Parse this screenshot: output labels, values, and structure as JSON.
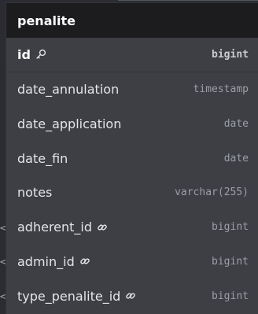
{
  "table": {
    "title": "penalite",
    "columns": [
      {
        "name": "id",
        "type": "bigint",
        "icon": "key-icon"
      },
      {
        "name": "date_annulation",
        "type": "timestamp"
      },
      {
        "name": "date_application",
        "type": "date"
      },
      {
        "name": "date_fin",
        "type": "date"
      },
      {
        "name": "notes",
        "type": "varchar(255)"
      },
      {
        "name": "adherent_id",
        "type": "bigint",
        "icon": "link-icon"
      },
      {
        "name": "admin_id",
        "type": "bigint",
        "icon": "link-icon"
      },
      {
        "name": "type_penalite_id",
        "type": "bigint",
        "icon": "link-icon"
      }
    ]
  },
  "colors": {
    "header_bg": "#1c1c1f",
    "body_bg": "#3d3f45",
    "canvas_bg": "#2b2c31"
  }
}
